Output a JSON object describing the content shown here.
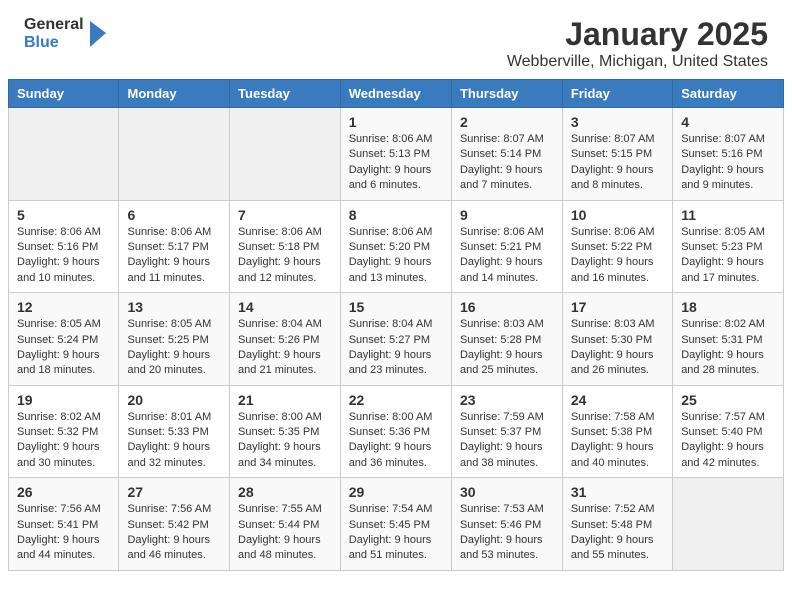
{
  "header": {
    "logo_line1": "General",
    "logo_line2": "Blue",
    "month": "January 2025",
    "location": "Webberville, Michigan, United States"
  },
  "weekdays": [
    "Sunday",
    "Monday",
    "Tuesday",
    "Wednesday",
    "Thursday",
    "Friday",
    "Saturday"
  ],
  "weeks": [
    [
      {
        "day": "",
        "info": ""
      },
      {
        "day": "",
        "info": ""
      },
      {
        "day": "",
        "info": ""
      },
      {
        "day": "1",
        "info": "Sunrise: 8:06 AM\nSunset: 5:13 PM\nDaylight: 9 hours and 6 minutes."
      },
      {
        "day": "2",
        "info": "Sunrise: 8:07 AM\nSunset: 5:14 PM\nDaylight: 9 hours and 7 minutes."
      },
      {
        "day": "3",
        "info": "Sunrise: 8:07 AM\nSunset: 5:15 PM\nDaylight: 9 hours and 8 minutes."
      },
      {
        "day": "4",
        "info": "Sunrise: 8:07 AM\nSunset: 5:16 PM\nDaylight: 9 hours and 9 minutes."
      }
    ],
    [
      {
        "day": "5",
        "info": "Sunrise: 8:06 AM\nSunset: 5:16 PM\nDaylight: 9 hours and 10 minutes."
      },
      {
        "day": "6",
        "info": "Sunrise: 8:06 AM\nSunset: 5:17 PM\nDaylight: 9 hours and 11 minutes."
      },
      {
        "day": "7",
        "info": "Sunrise: 8:06 AM\nSunset: 5:18 PM\nDaylight: 9 hours and 12 minutes."
      },
      {
        "day": "8",
        "info": "Sunrise: 8:06 AM\nSunset: 5:20 PM\nDaylight: 9 hours and 13 minutes."
      },
      {
        "day": "9",
        "info": "Sunrise: 8:06 AM\nSunset: 5:21 PM\nDaylight: 9 hours and 14 minutes."
      },
      {
        "day": "10",
        "info": "Sunrise: 8:06 AM\nSunset: 5:22 PM\nDaylight: 9 hours and 16 minutes."
      },
      {
        "day": "11",
        "info": "Sunrise: 8:05 AM\nSunset: 5:23 PM\nDaylight: 9 hours and 17 minutes."
      }
    ],
    [
      {
        "day": "12",
        "info": "Sunrise: 8:05 AM\nSunset: 5:24 PM\nDaylight: 9 hours and 18 minutes."
      },
      {
        "day": "13",
        "info": "Sunrise: 8:05 AM\nSunset: 5:25 PM\nDaylight: 9 hours and 20 minutes."
      },
      {
        "day": "14",
        "info": "Sunrise: 8:04 AM\nSunset: 5:26 PM\nDaylight: 9 hours and 21 minutes."
      },
      {
        "day": "15",
        "info": "Sunrise: 8:04 AM\nSunset: 5:27 PM\nDaylight: 9 hours and 23 minutes."
      },
      {
        "day": "16",
        "info": "Sunrise: 8:03 AM\nSunset: 5:28 PM\nDaylight: 9 hours and 25 minutes."
      },
      {
        "day": "17",
        "info": "Sunrise: 8:03 AM\nSunset: 5:30 PM\nDaylight: 9 hours and 26 minutes."
      },
      {
        "day": "18",
        "info": "Sunrise: 8:02 AM\nSunset: 5:31 PM\nDaylight: 9 hours and 28 minutes."
      }
    ],
    [
      {
        "day": "19",
        "info": "Sunrise: 8:02 AM\nSunset: 5:32 PM\nDaylight: 9 hours and 30 minutes."
      },
      {
        "day": "20",
        "info": "Sunrise: 8:01 AM\nSunset: 5:33 PM\nDaylight: 9 hours and 32 minutes."
      },
      {
        "day": "21",
        "info": "Sunrise: 8:00 AM\nSunset: 5:35 PM\nDaylight: 9 hours and 34 minutes."
      },
      {
        "day": "22",
        "info": "Sunrise: 8:00 AM\nSunset: 5:36 PM\nDaylight: 9 hours and 36 minutes."
      },
      {
        "day": "23",
        "info": "Sunrise: 7:59 AM\nSunset: 5:37 PM\nDaylight: 9 hours and 38 minutes."
      },
      {
        "day": "24",
        "info": "Sunrise: 7:58 AM\nSunset: 5:38 PM\nDaylight: 9 hours and 40 minutes."
      },
      {
        "day": "25",
        "info": "Sunrise: 7:57 AM\nSunset: 5:40 PM\nDaylight: 9 hours and 42 minutes."
      }
    ],
    [
      {
        "day": "26",
        "info": "Sunrise: 7:56 AM\nSunset: 5:41 PM\nDaylight: 9 hours and 44 minutes."
      },
      {
        "day": "27",
        "info": "Sunrise: 7:56 AM\nSunset: 5:42 PM\nDaylight: 9 hours and 46 minutes."
      },
      {
        "day": "28",
        "info": "Sunrise: 7:55 AM\nSunset: 5:44 PM\nDaylight: 9 hours and 48 minutes."
      },
      {
        "day": "29",
        "info": "Sunrise: 7:54 AM\nSunset: 5:45 PM\nDaylight: 9 hours and 51 minutes."
      },
      {
        "day": "30",
        "info": "Sunrise: 7:53 AM\nSunset: 5:46 PM\nDaylight: 9 hours and 53 minutes."
      },
      {
        "day": "31",
        "info": "Sunrise: 7:52 AM\nSunset: 5:48 PM\nDaylight: 9 hours and 55 minutes."
      },
      {
        "day": "",
        "info": ""
      }
    ]
  ]
}
